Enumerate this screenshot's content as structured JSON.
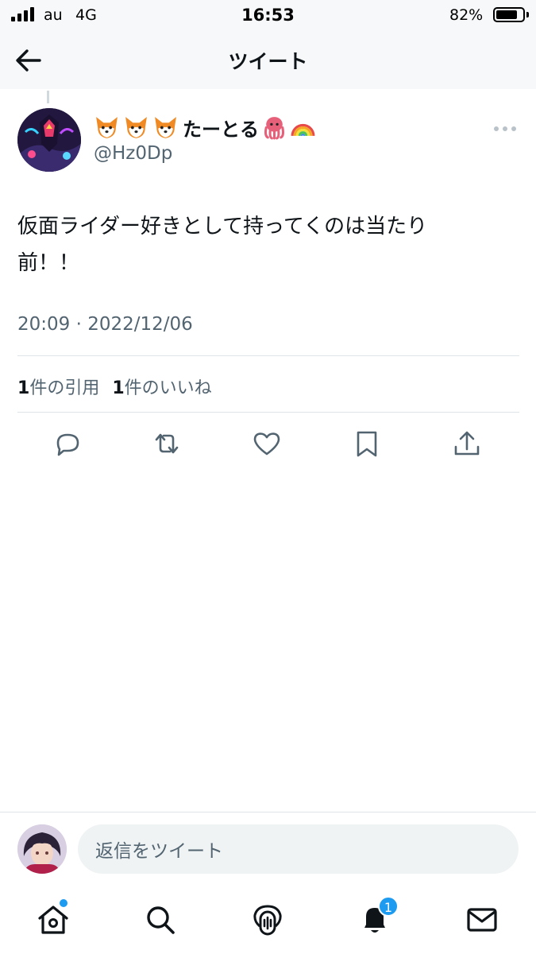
{
  "status_bar": {
    "carrier": "au",
    "network": "4G",
    "time": "16:53",
    "battery_text": "82%",
    "battery_level": 0.82
  },
  "header": {
    "title": "ツイート",
    "back_icon": "arrow-left-icon"
  },
  "tweet": {
    "author": {
      "name_emoji_prefix": [
        "fox-emoji",
        "fox-emoji",
        "fox-emoji"
      ],
      "display_name": "たーとる",
      "name_emoji_suffix": [
        "octopus-emoji",
        "rainbow-emoji"
      ],
      "handle": "@Hz0Dp"
    },
    "text_line1": "仮面ライダー好きとして持ってくのは当たり",
    "text_line2": "前！！",
    "timestamp": "20:09 · 2022/12/06",
    "stats": {
      "quotes_count": "1",
      "quotes_label": "件の引用",
      "likes_count": "1",
      "likes_label": "件のいいね"
    },
    "actions": [
      "reply-icon",
      "retweet-icon",
      "like-icon",
      "bookmark-icon",
      "share-icon"
    ]
  },
  "reply": {
    "placeholder": "返信をツイート"
  },
  "tabbar": {
    "tabs": [
      "home-icon",
      "search-icon",
      "spaces-icon",
      "notifications-icon",
      "messages-icon"
    ],
    "notification_badge": "1",
    "accent_color": "#1d9bf0"
  }
}
